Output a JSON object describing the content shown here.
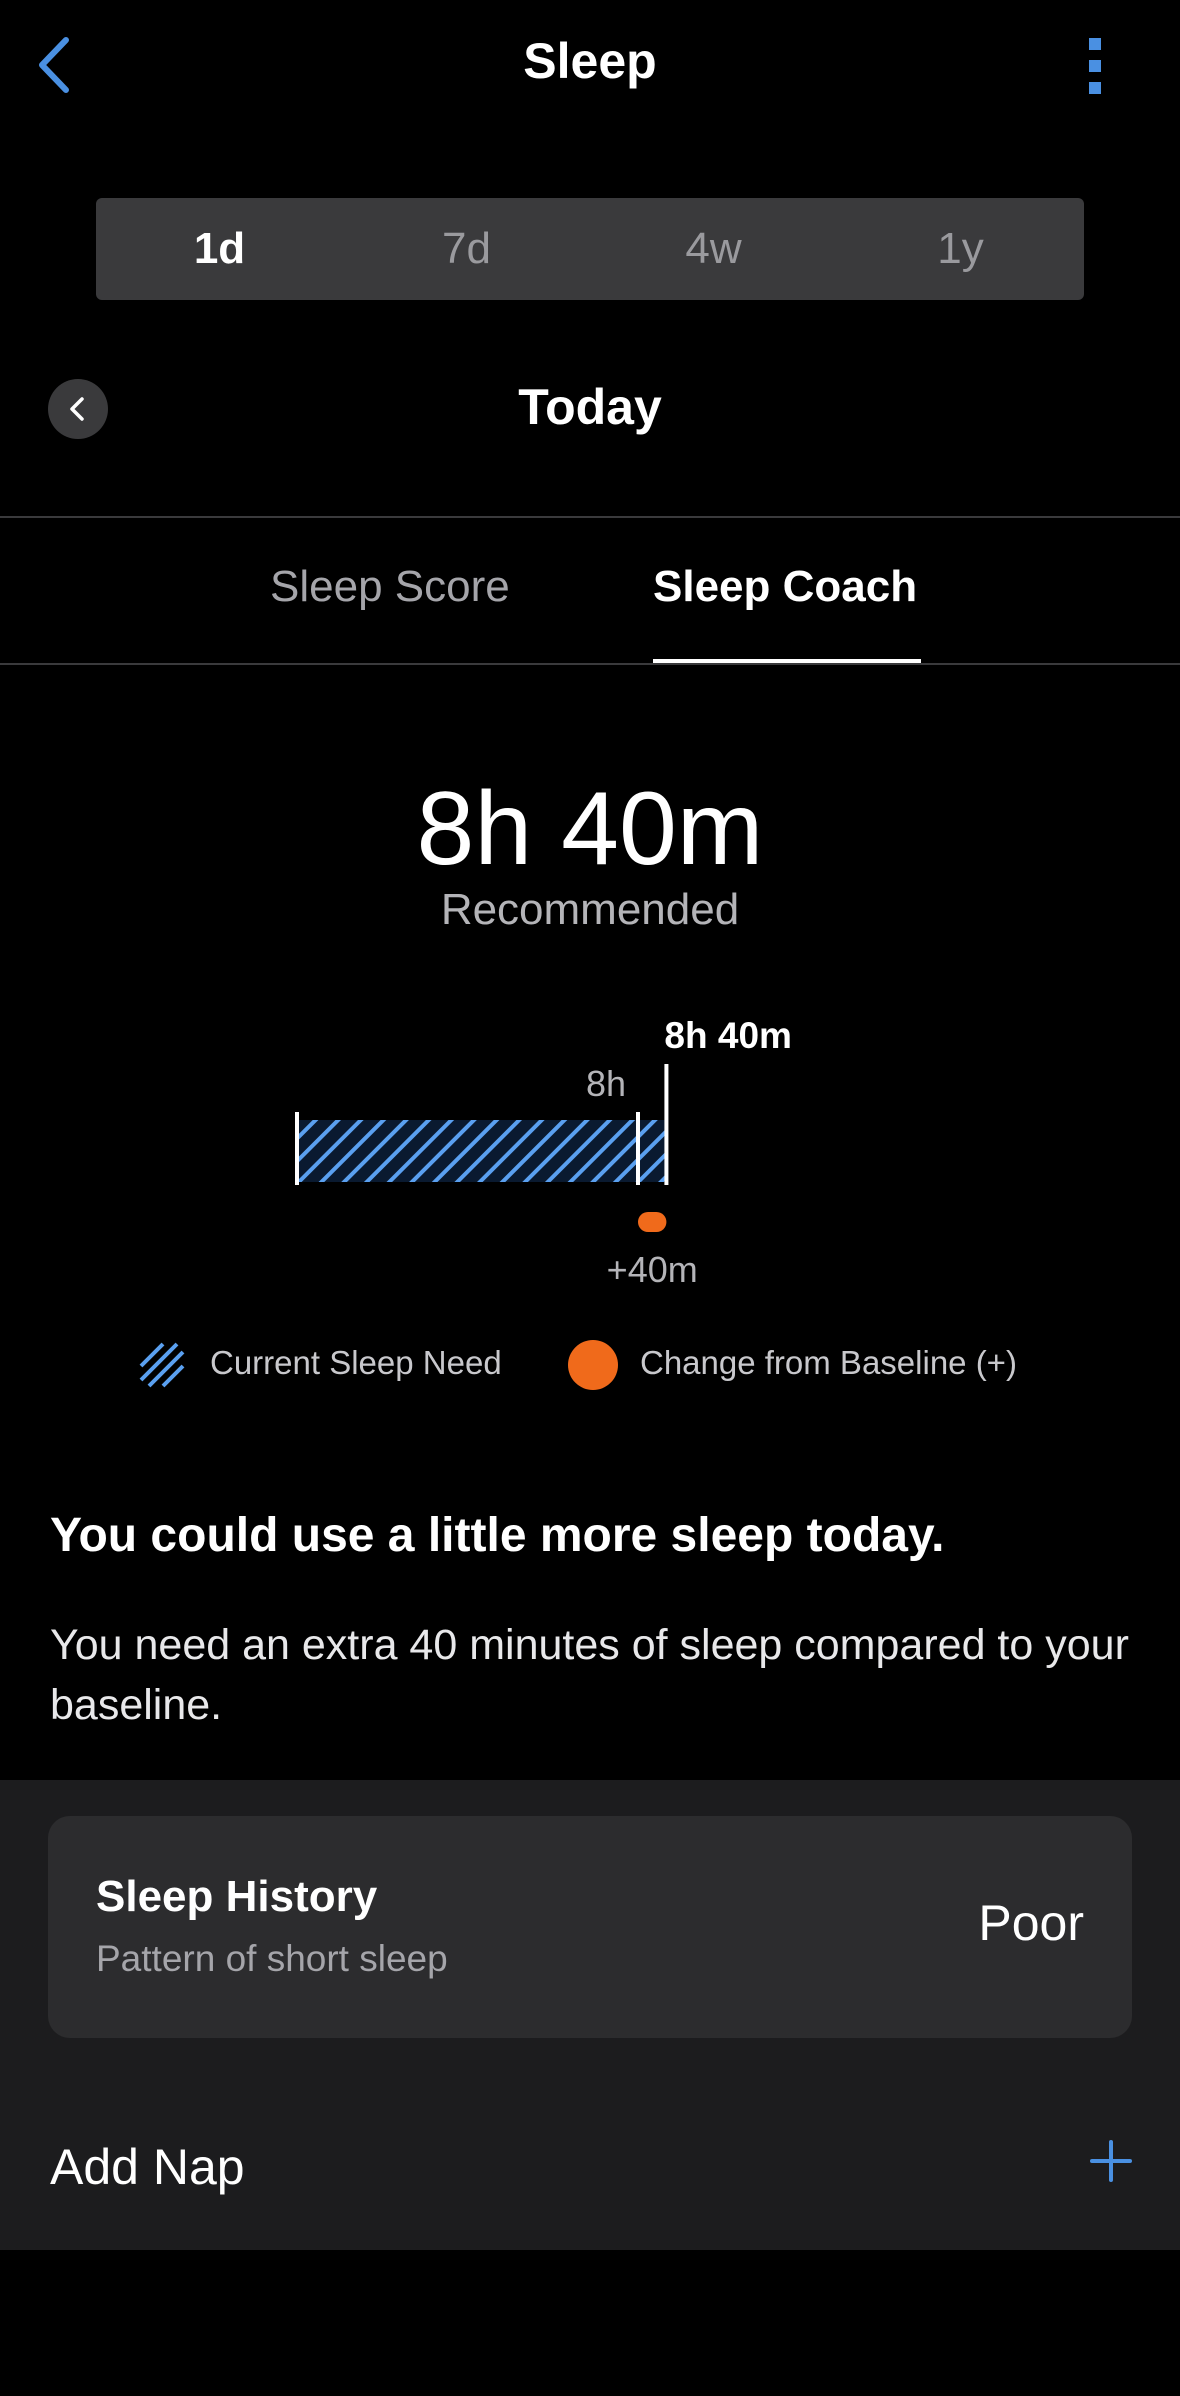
{
  "header": {
    "title": "Sleep",
    "back_icon": "chevron-left-icon",
    "more_icon": "more-vertical-icon"
  },
  "range_tabs": [
    {
      "label": "1d",
      "active": true
    },
    {
      "label": "7d",
      "active": false
    },
    {
      "label": "4w",
      "active": false
    },
    {
      "label": "1y",
      "active": false
    }
  ],
  "date_nav": {
    "label": "Today",
    "prev_icon": "chevron-left-icon"
  },
  "view_tabs": [
    {
      "label": "Sleep Score",
      "active": false
    },
    {
      "label": "Sleep Coach",
      "active": true
    }
  ],
  "recommended": {
    "value": "8h 40m",
    "label": "Recommended"
  },
  "chart_data": {
    "type": "bar",
    "unit": "minutes",
    "baseline_minutes": 480,
    "recommended_minutes": 520,
    "change_minutes": 40,
    "baseline_label": "8h",
    "recommended_label": "8h 40m",
    "change_label": "+40m"
  },
  "legend": [
    {
      "label": "Current Sleep Need",
      "icon": "hatched-swatch",
      "color": "#5aa0f0"
    },
    {
      "label": "Change from Baseline (+)",
      "icon": "dot",
      "color": "#f06a1b"
    }
  ],
  "message": {
    "headline": "You could use a little more sleep today.",
    "body": "You need an extra 40 minutes of sleep compared to your baseline."
  },
  "sleep_history": {
    "title": "Sleep History",
    "subtitle": "Pattern of short sleep",
    "value": "Poor"
  },
  "add_nap": {
    "label": "Add Nap",
    "icon": "plus-icon"
  },
  "colors": {
    "accent": "#4a90e2",
    "orange": "#f06a1b",
    "background": "#000000",
    "card": "#2c2c2e"
  }
}
